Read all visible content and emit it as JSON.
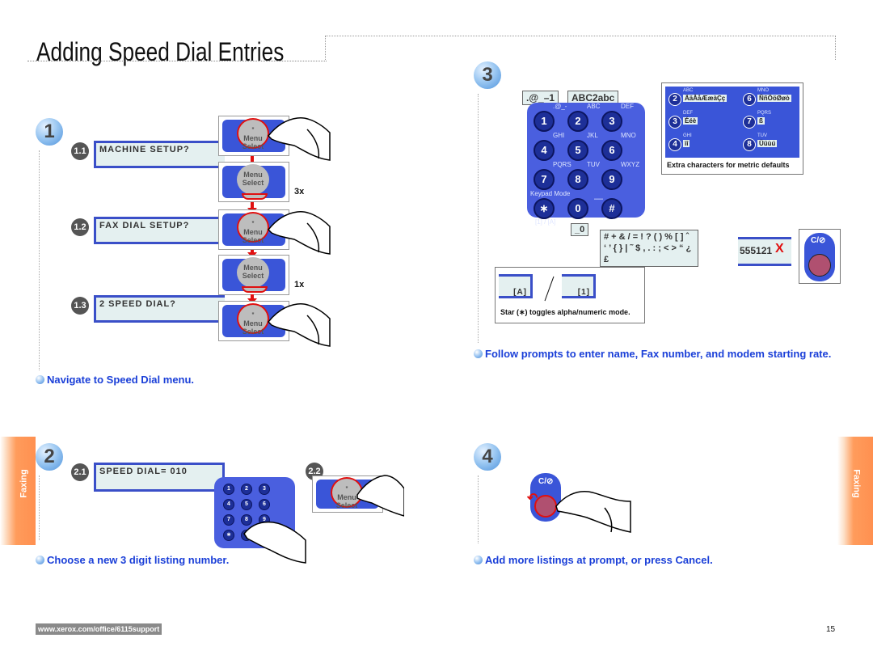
{
  "page": {
    "title": "Adding Speed Dial Entries",
    "page_number": "15",
    "footer_url": "www.xerox.com/office/6115support",
    "section_tab": "Faxing",
    "colors": {
      "accent_blue": "#1a3fd8",
      "panel_blue": "#3a55d8",
      "alert_red": "#e01010",
      "tab_orange": "#ff9050",
      "lcd_bg": "#e4f0f0"
    }
  },
  "step1": {
    "number": "1",
    "substeps": [
      {
        "id": "1.1",
        "lcd": "MACHINE SETUP?"
      },
      {
        "id": "1.2",
        "lcd": "FAX DIAL SETUP?"
      },
      {
        "id": "1.3",
        "lcd": "2 SPEED DIAL?"
      }
    ],
    "repeat_labels": [
      "3x",
      "1x"
    ],
    "button_label_top": "Menu",
    "button_label_bottom": "Select",
    "hint": "Navigate to Speed Dial menu."
  },
  "step2": {
    "number": "2",
    "substep1": {
      "id": "2.1",
      "lcd": "SPEED DIAL= 010"
    },
    "substep2": {
      "id": "2.2"
    },
    "hint": "Choose a new 3 digit listing number."
  },
  "step3": {
    "number": "3",
    "callout_key1": ".@_–1",
    "callout_key2": "ABC2abc",
    "callout_key0": "_0",
    "callout_hash_line1": "# + & / = ! ? ( ) % [ ] ˆ",
    "callout_hash_line2": "‘ ’ { } | ˜ $ , . : ; < > “ ¿ £",
    "keypad": {
      "keys": [
        {
          "digit": "1",
          "letters": ".@_-"
        },
        {
          "digit": "2",
          "letters": "ABC"
        },
        {
          "digit": "3",
          "letters": "DEF"
        },
        {
          "digit": "4",
          "letters": "GHI"
        },
        {
          "digit": "5",
          "letters": "JKL"
        },
        {
          "digit": "6",
          "letters": "MNO"
        },
        {
          "digit": "7",
          "letters": "PQRS"
        },
        {
          "digit": "8",
          "letters": "TUV"
        },
        {
          "digit": "9",
          "letters": "WXYZ"
        },
        {
          "digit": "∗",
          "letters": "Keypad Mode"
        },
        {
          "digit": "0",
          "letters": ""
        },
        {
          "digit": "#",
          "letters": ""
        }
      ],
      "mode_label": "[1] / [A]",
      "space_label": "—"
    },
    "extra_chars": {
      "caption": "Extra characters for metric defaults",
      "entries": [
        {
          "digit": "2",
          "letters": "ABC",
          "chars": "ÄäÅåÆæàÇç"
        },
        {
          "digit": "6",
          "letters": "MNO",
          "chars": "ÑñÖöØøò"
        },
        {
          "digit": "3",
          "letters": "DEF",
          "chars": "Ééè"
        },
        {
          "digit": "7",
          "letters": "PQRS",
          "chars": "ß"
        },
        {
          "digit": "4",
          "letters": "GHI",
          "chars": "ìî"
        },
        {
          "digit": "8",
          "letters": "TUV",
          "chars": "Üüùú"
        }
      ]
    },
    "mode_box": {
      "alpha": "[A]",
      "numeric": "[1]",
      "caption": "Star (∗) toggles alpha/numeric mode."
    },
    "correction": {
      "entry": "555121",
      "delete_mark": "X",
      "clear_key": "C/⊘"
    },
    "hint": "Follow prompts to enter name, Fax number, and modem starting rate."
  },
  "step4": {
    "number": "4",
    "clear_key": "C/⊘",
    "hint": "Add more listings at prompt, or press Cancel."
  }
}
